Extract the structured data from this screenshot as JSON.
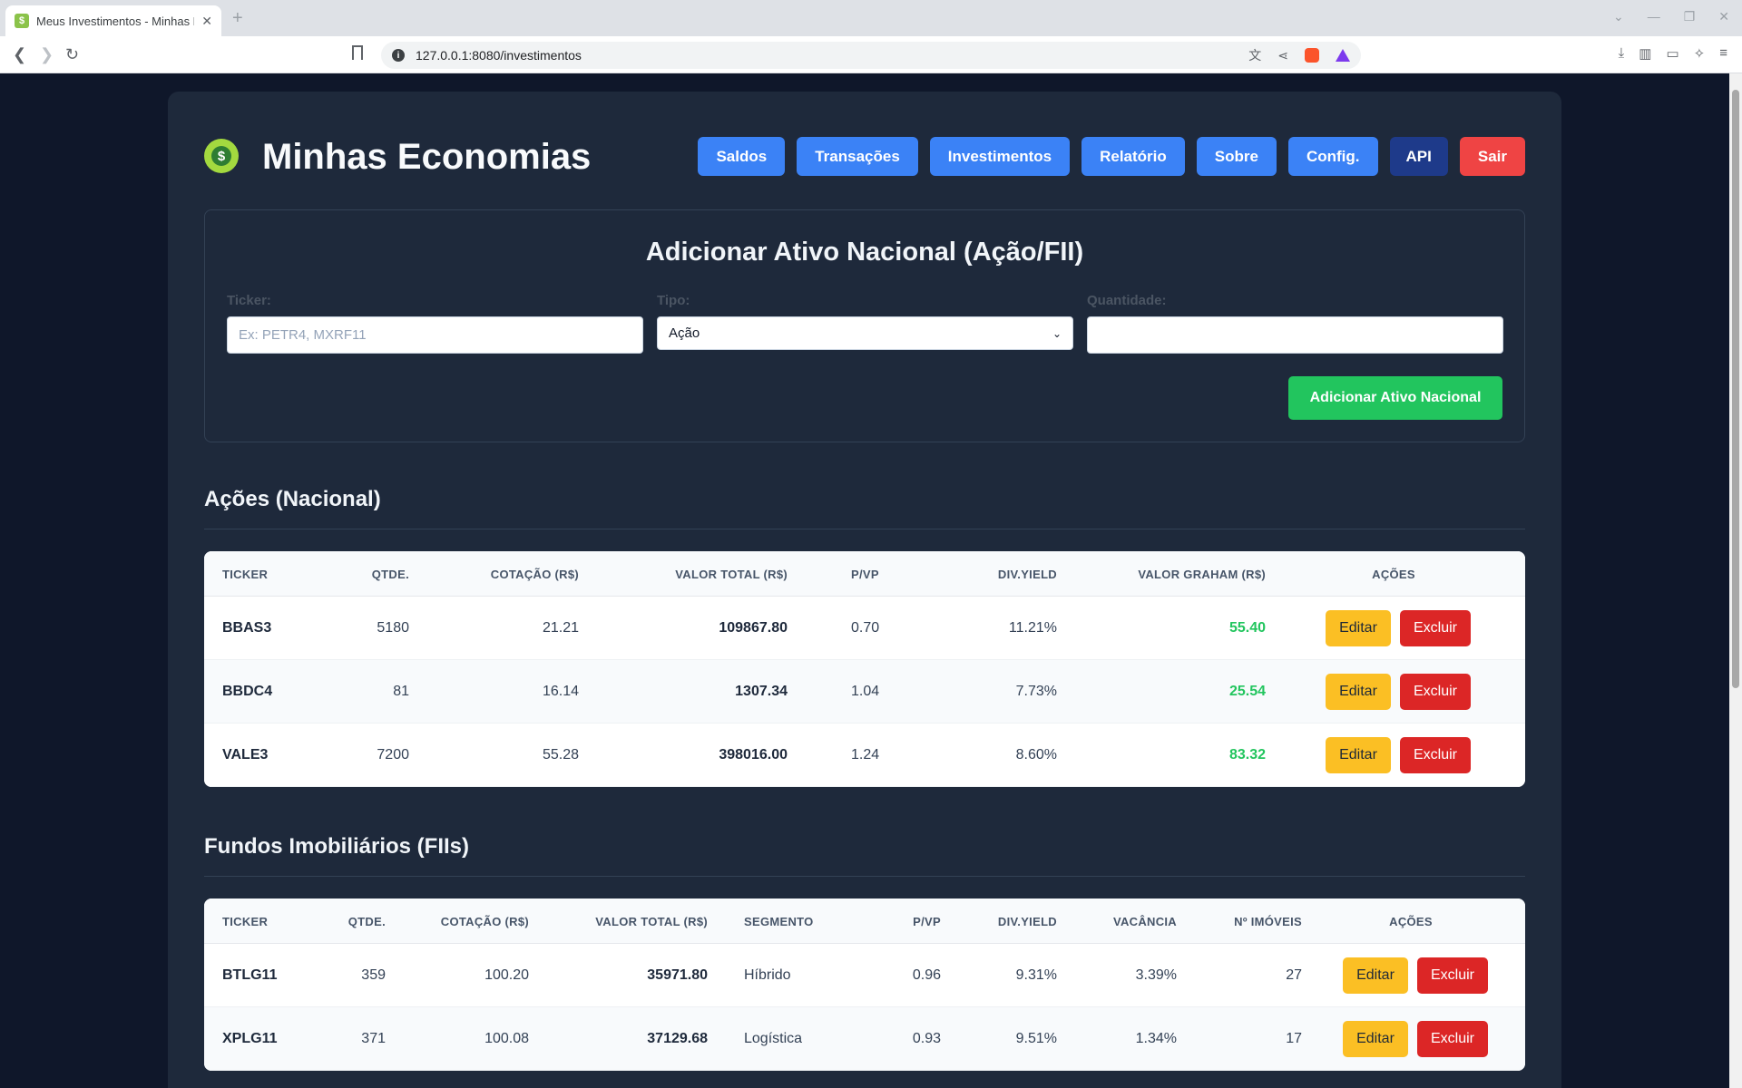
{
  "browser": {
    "tab_title": "Meus Investimentos - Minhas Economias",
    "tab_close": "✕",
    "new_tab": "+",
    "url": "127.0.0.1:8080/investimentos"
  },
  "app": {
    "title": "Minhas Economias",
    "logo_symbol": "$"
  },
  "nav": {
    "saldos": "Saldos",
    "transacoes": "Transações",
    "investimentos": "Investimentos",
    "relatorio": "Relatório",
    "sobre": "Sobre",
    "config": "Config.",
    "api": "API",
    "sair": "Sair"
  },
  "form": {
    "title": "Adicionar Ativo Nacional (Ação/FII)",
    "ticker_label": "Ticker:",
    "ticker_placeholder": "Ex: PETR4, MXRF11",
    "tipo_label": "Tipo:",
    "tipo_value": "Ação",
    "quantidade_label": "Quantidade:",
    "quantidade_value": "",
    "submit": "Adicionar Ativo Nacional"
  },
  "acoes": {
    "title": "Ações (Nacional)",
    "headers": {
      "ticker": "TICKER",
      "qtde": "QTDE.",
      "cotacao": "COTAÇÃO (R$)",
      "valor_total": "VALOR TOTAL (R$)",
      "pvp": "P/VP",
      "div_yield": "DIV.YIELD",
      "graham": "VALOR GRAHAM (R$)",
      "acoes": "AÇÕES"
    },
    "rows": [
      {
        "ticker": "BBAS3",
        "qtde": "5180",
        "cotacao": "21.21",
        "valor_total": "109867.80",
        "pvp": "0.70",
        "div_yield": "11.21%",
        "graham": "55.40",
        "edit": "Editar",
        "del": "Excluir"
      },
      {
        "ticker": "BBDC4",
        "qtde": "81",
        "cotacao": "16.14",
        "valor_total": "1307.34",
        "pvp": "1.04",
        "div_yield": "7.73%",
        "graham": "25.54",
        "edit": "Editar",
        "del": "Excluir"
      },
      {
        "ticker": "VALE3",
        "qtde": "7200",
        "cotacao": "55.28",
        "valor_total": "398016.00",
        "pvp": "1.24",
        "div_yield": "8.60%",
        "graham": "83.32",
        "edit": "Editar",
        "del": "Excluir"
      }
    ]
  },
  "fiis": {
    "title": "Fundos Imobiliários (FIIs)",
    "headers": {
      "ticker": "TICKER",
      "qtde": "QTDE.",
      "cotacao": "COTAÇÃO (R$)",
      "valor_total": "VALOR TOTAL (R$)",
      "segmento": "SEGMENTO",
      "pvp": "P/VP",
      "div_yield": "DIV.YIELD",
      "vacancia": "VACÂNCIA",
      "imoveis": "Nº IMÓVEIS",
      "acoes": "AÇÕES"
    },
    "rows": [
      {
        "ticker": "BTLG11",
        "qtde": "359",
        "cotacao": "100.20",
        "valor_total": "35971.80",
        "segmento": "Híbrido",
        "pvp": "0.96",
        "div_yield": "9.31%",
        "vacancia": "3.39%",
        "imoveis": "27",
        "edit": "Editar",
        "del": "Excluir"
      },
      {
        "ticker": "XPLG11",
        "qtde": "371",
        "cotacao": "100.08",
        "valor_total": "37129.68",
        "segmento": "Logística",
        "pvp": "0.93",
        "div_yield": "9.51%",
        "vacancia": "1.34%",
        "imoveis": "17",
        "edit": "Editar",
        "del": "Excluir"
      }
    ]
  },
  "colors": {
    "page_bg": "#0f172a",
    "card_bg": "#1e293b",
    "nav_blue": "#3b82f6",
    "api_navy": "#1e3a8a",
    "danger": "#ef4444",
    "success": "#22c55e",
    "warning": "#fbbf24"
  }
}
